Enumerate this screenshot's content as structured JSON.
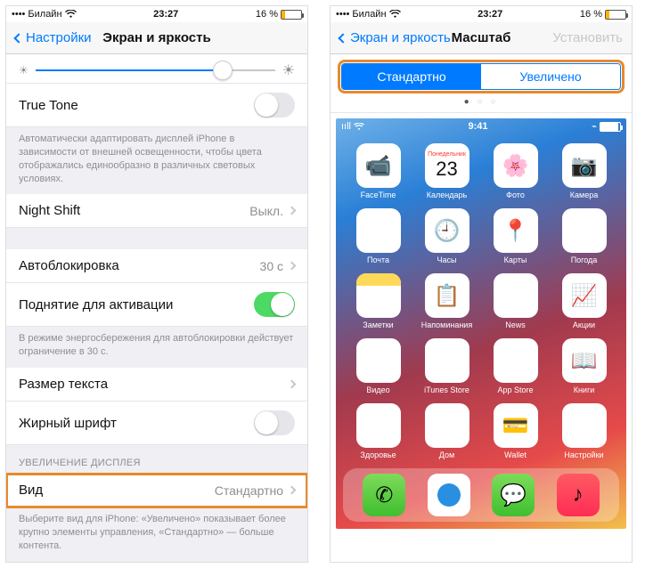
{
  "left": {
    "status": {
      "carrier": "Билайн",
      "time": "23:27",
      "battery": "16 %"
    },
    "nav": {
      "back": "Настройки",
      "title": "Экран и яркость"
    },
    "rows": {
      "trueTone": "True Tone",
      "trueToneNote": "Автоматически адаптировать дисплей iPhone в зависимости от внешней освещенности, чтобы цвета отображались единообразно в различных световых условиях.",
      "nightShift": "Night Shift",
      "nightShiftValue": "Выкл.",
      "autoLock": "Автоблокировка",
      "autoLockValue": "30 с",
      "raiseToWake": "Поднятие для активации",
      "powerNote": "В режиме энергосбережения для автоблокировки действует ограничение в 30 с.",
      "textSize": "Размер текста",
      "boldText": "Жирный шрифт",
      "zoomHeader": "УВЕЛИЧЕНИЕ ДИСПЛЕЯ",
      "view": "Вид",
      "viewValue": "Стандартно",
      "viewNote": "Выберите вид для iPhone: «Увеличено» показывает более крупно элементы управления, «Стандартно» — больше контента."
    }
  },
  "right": {
    "status": {
      "carrier": "Билайн",
      "time": "23:27",
      "battery": "16 %"
    },
    "nav": {
      "back": "Экран и яркость",
      "title": "Масштаб",
      "action": "Установить"
    },
    "seg": {
      "standard": "Стандартно",
      "zoomed": "Увеличено"
    },
    "preview": {
      "time": "9:41",
      "calDay": "Понедельник",
      "calNum": "23",
      "apps": [
        "FaceTime",
        "Календарь",
        "Фото",
        "Камера",
        "Почта",
        "Часы",
        "Карты",
        "Погода",
        "Заметки",
        "Напоминания",
        "News",
        "Акции",
        "Видео",
        "iTunes Store",
        "App Store",
        "Книги",
        "Здоровье",
        "Дом",
        "Wallet",
        "Настройки"
      ]
    }
  }
}
